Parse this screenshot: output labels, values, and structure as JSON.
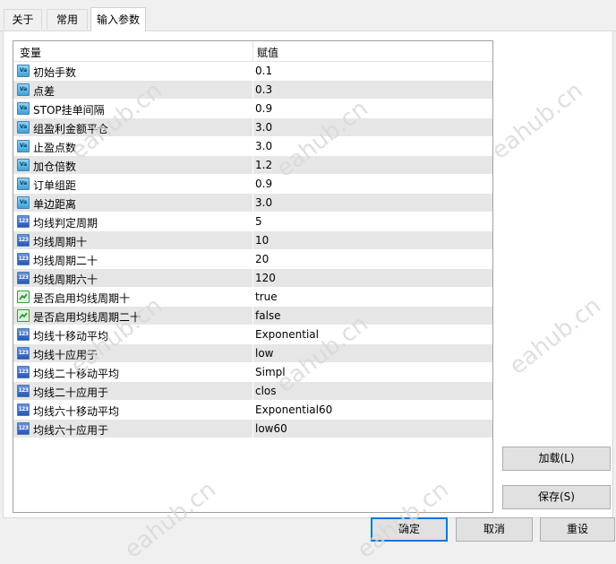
{
  "tabs": [
    {
      "label": "关于"
    },
    {
      "label": "常用"
    },
    {
      "label": "输入参数"
    }
  ],
  "table": {
    "columns": [
      "变量",
      "赋值"
    ],
    "rows": [
      {
        "name": "初始手数",
        "value": "0.1",
        "icon": "va-icon"
      },
      {
        "name": "点差",
        "value": "0.3",
        "icon": "va-icon"
      },
      {
        "name": "STOP挂单间隔",
        "value": "0.9",
        "icon": "va-icon"
      },
      {
        "name": "组盈利金额平仓",
        "value": "3.0",
        "icon": "va-icon"
      },
      {
        "name": "止盈点数",
        "value": "3.0",
        "icon": "va-icon"
      },
      {
        "name": "加仓倍数",
        "value": "1.2",
        "icon": "va-icon"
      },
      {
        "name": "订单组距",
        "value": "0.9",
        "icon": "va-icon"
      },
      {
        "name": "单边距离",
        "value": "3.0",
        "icon": "va-icon"
      },
      {
        "name": "均线判定周期",
        "value": "5",
        "icon": "integer-123-icon"
      },
      {
        "name": "均线周期十",
        "value": "10",
        "icon": "integer-123-icon"
      },
      {
        "name": "均线周期二十",
        "value": "20",
        "icon": "integer-123-icon"
      },
      {
        "name": "均线周期六十",
        "value": "120",
        "icon": "integer-123-icon"
      },
      {
        "name": "是否启用均线周期十",
        "value": "true",
        "icon": "boolean-icon"
      },
      {
        "name": "是否启用均线周期二十",
        "value": "false",
        "icon": "boolean-icon"
      },
      {
        "name": "均线十移动平均",
        "value": "Exponential",
        "icon": "integer-123-icon"
      },
      {
        "name": "均线十应用于",
        "value": "low",
        "icon": "integer-123-icon"
      },
      {
        "name": "均线二十移动平均",
        "value": "Simpl",
        "icon": "integer-123-icon"
      },
      {
        "name": "均线二十应用于",
        "value": "clos",
        "icon": "integer-123-icon"
      },
      {
        "name": "均线六十移动平均",
        "value": "Exponential60",
        "icon": "integer-123-icon"
      },
      {
        "name": "均线六十应用于",
        "value": "low60",
        "icon": "integer-123-icon"
      }
    ]
  },
  "buttons": {
    "load": "加载(L)",
    "save": "保存(S)",
    "ok": "确定",
    "cancel": "取消",
    "reset": "重设"
  },
  "watermark": "eahub.cn",
  "colors": {
    "row_shade": "#e6e6e6",
    "primary_border": "#0078d7"
  }
}
